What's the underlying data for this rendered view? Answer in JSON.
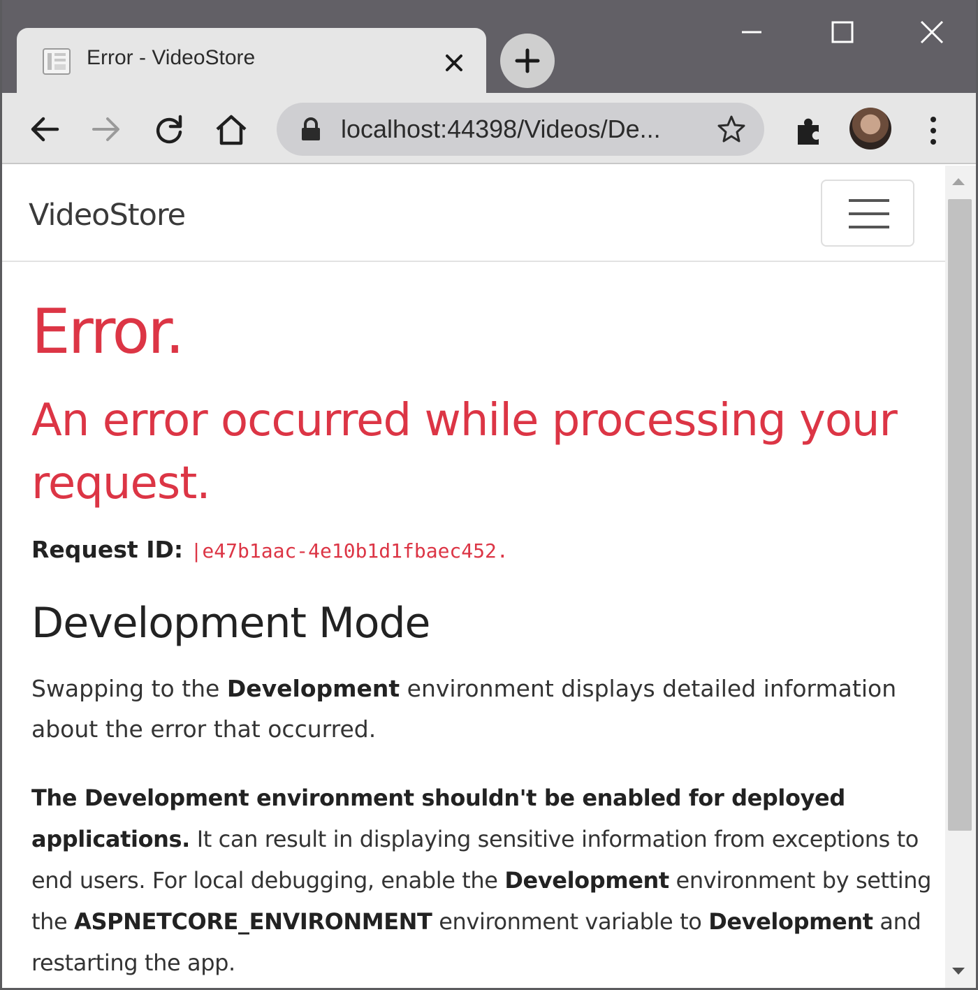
{
  "browser": {
    "tab": {
      "title": "Error - VideoStore",
      "favicon": "page-icon",
      "close": "close-icon"
    },
    "new_tab": "plus-icon",
    "window_controls": [
      "minimize-icon",
      "maximize-icon",
      "close-icon"
    ],
    "nav": [
      "back-arrow-icon",
      "forward-arrow-icon",
      "reload-icon",
      "home-icon"
    ],
    "address": {
      "url": "localhost:44398/Videos/De...",
      "lock": "lock-icon",
      "bookmark": "star-icon"
    },
    "extensions": "puzzle-icon",
    "menu": "kebab-menu-icon"
  },
  "page": {
    "brand": "VideoStore",
    "menu_toggle": "hamburger-icon",
    "heading": "Error.",
    "subheading": "An error occurred while processing your request.",
    "request_label": "Request ID:",
    "request_id": "|e47b1aac-4e10b1d1fbaec452.",
    "dev_heading": "Development Mode",
    "p1": {
      "t1": "Swapping to the ",
      "b1": "Development",
      "t2": " environment displays detailed information about the error that occurred."
    },
    "p2": {
      "b1": "The Development environment shouldn't be enabled for deployed applications.",
      "t1": " It can result in displaying sensitive information from exceptions to end users. For local debugging, enable the ",
      "b2": "Development",
      "t2": " environment by setting the ",
      "b3": "ASPNETCORE_ENVIRONMENT",
      "t3": " environment variable to ",
      "b4": "Development",
      "t4": " and restarting the app."
    }
  },
  "colors": {
    "error": "#dc3545",
    "titlebar": "#626066",
    "toolbar": "#e6e6e6"
  }
}
